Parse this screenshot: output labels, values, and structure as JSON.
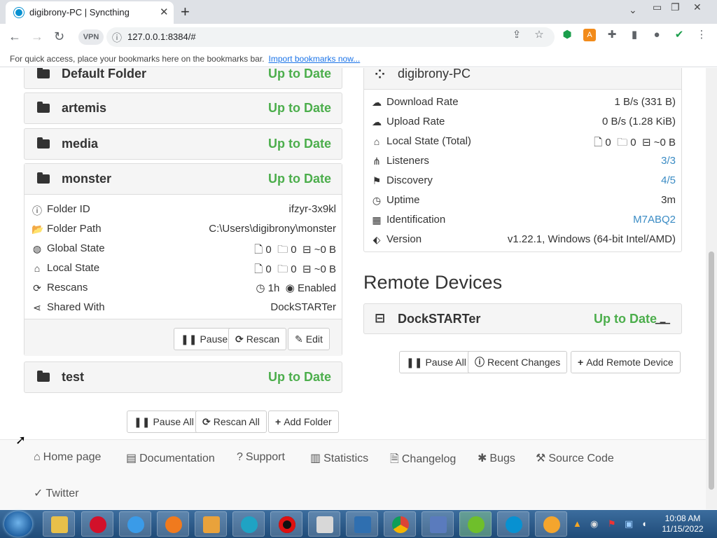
{
  "browser": {
    "tab_title": "digibrony-PC | Syncthing",
    "url": "127.0.0.1:8384/#",
    "vpn_label": "VPN",
    "bookmarks_prompt": "For quick access, place your bookmarks here on the bookmarks bar.",
    "bookmarks_link": "Import bookmarks now..."
  },
  "folders": {
    "default": {
      "name": "Default Folder",
      "status": "Up to Date"
    },
    "artemis": {
      "name": "artemis",
      "status": "Up to Date"
    },
    "media": {
      "name": "media",
      "status": "Up to Date"
    },
    "monster": {
      "name": "monster",
      "status": "Up to Date",
      "folder_id_label": "Folder ID",
      "folder_id": "ifzyr-3x9kl",
      "folder_path_label": "Folder Path",
      "folder_path": "C:\\Users\\digibrony\\monster",
      "global_state_label": "Global State",
      "global_files": "0",
      "global_dirs": "0",
      "global_size": "~0 B",
      "local_state_label": "Local State",
      "local_files": "0",
      "local_dirs": "0",
      "local_size": "~0 B",
      "rescans_label": "Rescans",
      "rescans_interval": "1h",
      "rescans_watch": "Enabled",
      "shared_with_label": "Shared With",
      "shared_with": "DockSTARTer",
      "pause_button": "Pause",
      "rescan_button": "Rescan",
      "edit_button": "Edit"
    },
    "test": {
      "name": "test",
      "status": "Up to Date"
    },
    "pause_all": "Pause All",
    "rescan_all": "Rescan All",
    "add_folder": "Add Folder"
  },
  "this_device": {
    "name": "digibrony-PC",
    "download_rate_label": "Download Rate",
    "download_rate": "1 B/s (331 B)",
    "upload_rate_label": "Upload Rate",
    "upload_rate": "0 B/s (1.28 KiB)",
    "local_state_label": "Local State (Total)",
    "local_files": "0",
    "local_dirs": "0",
    "local_size": "~0 B",
    "listeners_label": "Listeners",
    "listeners": "3/3",
    "discovery_label": "Discovery",
    "discovery": "4/5",
    "uptime_label": "Uptime",
    "uptime": "3m",
    "identification_label": "Identification",
    "identification": "M7ABQ2",
    "version_label": "Version",
    "version": "v1.22.1, Windows (64-bit Intel/AMD)"
  },
  "remote_devices": {
    "heading": "Remote Devices",
    "device_name": "DockSTARTer",
    "device_status": "Up to Date",
    "pause_all": "Pause All",
    "recent_changes": "Recent Changes",
    "add_remote_device": "Add Remote Device"
  },
  "footer": {
    "home_page": "Home page",
    "documentation": "Documentation",
    "support": "Support",
    "statistics": "Statistics",
    "changelog": "Changelog",
    "bugs": "Bugs",
    "source_code": "Source Code",
    "twitter": "Twitter"
  },
  "taskbar": {
    "time": "10:08 AM",
    "date": "11/15/2022"
  }
}
